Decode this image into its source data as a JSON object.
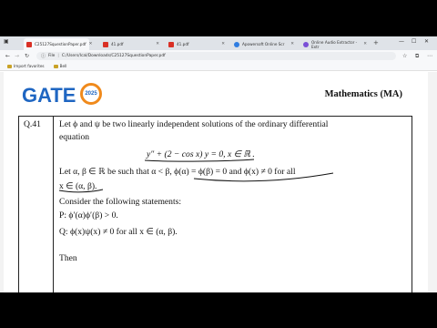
{
  "browser": {
    "tabs": [
      {
        "title": "C25127SquestionPaper.pdf",
        "icon": "pdf-icon",
        "active": true
      },
      {
        "title": "41.pdf",
        "icon": "pdf-icon",
        "active": false
      },
      {
        "title": "41.pdf",
        "icon": "pdf-icon",
        "active": false
      },
      {
        "title": "Apowersoft Online Scr",
        "icon": "apowersoft-icon",
        "active": false
      },
      {
        "title": "Online Audio Extractor - Extr",
        "icon": "audio-extractor-icon",
        "active": false
      }
    ],
    "address_label": "File",
    "url": "C:/Users/Ical/Downloads/C25127SquestionPaper.pdf",
    "bookmarks": [
      "Import favorites",
      "Bell"
    ]
  },
  "document": {
    "logo_text": "GATE",
    "logo_badge": "2025",
    "subject": "Mathematics (MA)",
    "question_number": "Q.41",
    "lines": {
      "l1": "Let ϕ and ψ be two linearly independent solutions of the ordinary differential",
      "l2": "equation",
      "eq": "y″ + (2 − cos x) y  = 0,        x ∈ ℝ .",
      "l3": "Let α, β ∈ ℝ be such that α < β,  ϕ(α) =  ϕ(β) = 0 and ϕ(x) ≠ 0 for all",
      "l4": "x ∈ (α, β).",
      "l5": "Consider the following statements:",
      "p": "P:  ϕ′(α)ϕ′(β) > 0.",
      "q": "Q:  ϕ(x)ψ(x) ≠ 0 for all x ∈ (α, β).",
      "then": "Then"
    }
  },
  "colors": {
    "logo_blue": "#1f66c2",
    "logo_orange": "#f08a1c",
    "pdf_red": "#d93025"
  }
}
